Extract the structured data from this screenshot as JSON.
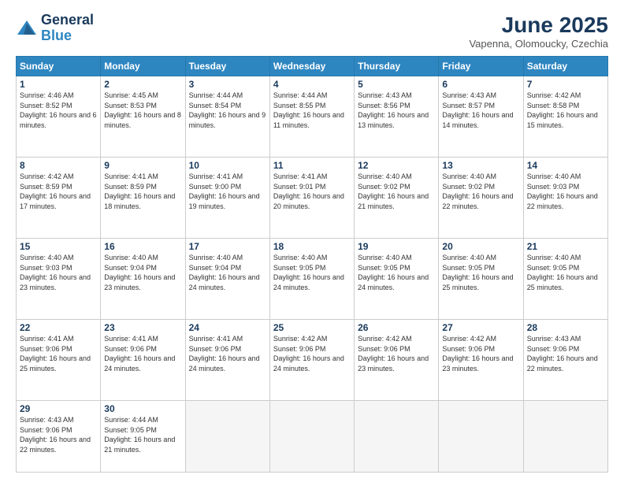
{
  "header": {
    "logo_line1": "General",
    "logo_line2": "Blue",
    "month_year": "June 2025",
    "location": "Vapenna, Olomoucky, Czechia"
  },
  "days_of_week": [
    "Sunday",
    "Monday",
    "Tuesday",
    "Wednesday",
    "Thursday",
    "Friday",
    "Saturday"
  ],
  "weeks": [
    [
      {
        "day": "1",
        "sunrise": "Sunrise: 4:46 AM",
        "sunset": "Sunset: 8:52 PM",
        "daylight": "Daylight: 16 hours and 6 minutes."
      },
      {
        "day": "2",
        "sunrise": "Sunrise: 4:45 AM",
        "sunset": "Sunset: 8:53 PM",
        "daylight": "Daylight: 16 hours and 8 minutes."
      },
      {
        "day": "3",
        "sunrise": "Sunrise: 4:44 AM",
        "sunset": "Sunset: 8:54 PM",
        "daylight": "Daylight: 16 hours and 9 minutes."
      },
      {
        "day": "4",
        "sunrise": "Sunrise: 4:44 AM",
        "sunset": "Sunset: 8:55 PM",
        "daylight": "Daylight: 16 hours and 11 minutes."
      },
      {
        "day": "5",
        "sunrise": "Sunrise: 4:43 AM",
        "sunset": "Sunset: 8:56 PM",
        "daylight": "Daylight: 16 hours and 13 minutes."
      },
      {
        "day": "6",
        "sunrise": "Sunrise: 4:43 AM",
        "sunset": "Sunset: 8:57 PM",
        "daylight": "Daylight: 16 hours and 14 minutes."
      },
      {
        "day": "7",
        "sunrise": "Sunrise: 4:42 AM",
        "sunset": "Sunset: 8:58 PM",
        "daylight": "Daylight: 16 hours and 15 minutes."
      }
    ],
    [
      {
        "day": "8",
        "sunrise": "Sunrise: 4:42 AM",
        "sunset": "Sunset: 8:59 PM",
        "daylight": "Daylight: 16 hours and 17 minutes."
      },
      {
        "day": "9",
        "sunrise": "Sunrise: 4:41 AM",
        "sunset": "Sunset: 8:59 PM",
        "daylight": "Daylight: 16 hours and 18 minutes."
      },
      {
        "day": "10",
        "sunrise": "Sunrise: 4:41 AM",
        "sunset": "Sunset: 9:00 PM",
        "daylight": "Daylight: 16 hours and 19 minutes."
      },
      {
        "day": "11",
        "sunrise": "Sunrise: 4:41 AM",
        "sunset": "Sunset: 9:01 PM",
        "daylight": "Daylight: 16 hours and 20 minutes."
      },
      {
        "day": "12",
        "sunrise": "Sunrise: 4:40 AM",
        "sunset": "Sunset: 9:02 PM",
        "daylight": "Daylight: 16 hours and 21 minutes."
      },
      {
        "day": "13",
        "sunrise": "Sunrise: 4:40 AM",
        "sunset": "Sunset: 9:02 PM",
        "daylight": "Daylight: 16 hours and 22 minutes."
      },
      {
        "day": "14",
        "sunrise": "Sunrise: 4:40 AM",
        "sunset": "Sunset: 9:03 PM",
        "daylight": "Daylight: 16 hours and 22 minutes."
      }
    ],
    [
      {
        "day": "15",
        "sunrise": "Sunrise: 4:40 AM",
        "sunset": "Sunset: 9:03 PM",
        "daylight": "Daylight: 16 hours and 23 minutes."
      },
      {
        "day": "16",
        "sunrise": "Sunrise: 4:40 AM",
        "sunset": "Sunset: 9:04 PM",
        "daylight": "Daylight: 16 hours and 23 minutes."
      },
      {
        "day": "17",
        "sunrise": "Sunrise: 4:40 AM",
        "sunset": "Sunset: 9:04 PM",
        "daylight": "Daylight: 16 hours and 24 minutes."
      },
      {
        "day": "18",
        "sunrise": "Sunrise: 4:40 AM",
        "sunset": "Sunset: 9:05 PM",
        "daylight": "Daylight: 16 hours and 24 minutes."
      },
      {
        "day": "19",
        "sunrise": "Sunrise: 4:40 AM",
        "sunset": "Sunset: 9:05 PM",
        "daylight": "Daylight: 16 hours and 24 minutes."
      },
      {
        "day": "20",
        "sunrise": "Sunrise: 4:40 AM",
        "sunset": "Sunset: 9:05 PM",
        "daylight": "Daylight: 16 hours and 25 minutes."
      },
      {
        "day": "21",
        "sunrise": "Sunrise: 4:40 AM",
        "sunset": "Sunset: 9:05 PM",
        "daylight": "Daylight: 16 hours and 25 minutes."
      }
    ],
    [
      {
        "day": "22",
        "sunrise": "Sunrise: 4:41 AM",
        "sunset": "Sunset: 9:06 PM",
        "daylight": "Daylight: 16 hours and 25 minutes."
      },
      {
        "day": "23",
        "sunrise": "Sunrise: 4:41 AM",
        "sunset": "Sunset: 9:06 PM",
        "daylight": "Daylight: 16 hours and 24 minutes."
      },
      {
        "day": "24",
        "sunrise": "Sunrise: 4:41 AM",
        "sunset": "Sunset: 9:06 PM",
        "daylight": "Daylight: 16 hours and 24 minutes."
      },
      {
        "day": "25",
        "sunrise": "Sunrise: 4:42 AM",
        "sunset": "Sunset: 9:06 PM",
        "daylight": "Daylight: 16 hours and 24 minutes."
      },
      {
        "day": "26",
        "sunrise": "Sunrise: 4:42 AM",
        "sunset": "Sunset: 9:06 PM",
        "daylight": "Daylight: 16 hours and 23 minutes."
      },
      {
        "day": "27",
        "sunrise": "Sunrise: 4:42 AM",
        "sunset": "Sunset: 9:06 PM",
        "daylight": "Daylight: 16 hours and 23 minutes."
      },
      {
        "day": "28",
        "sunrise": "Sunrise: 4:43 AM",
        "sunset": "Sunset: 9:06 PM",
        "daylight": "Daylight: 16 hours and 22 minutes."
      }
    ],
    [
      {
        "day": "29",
        "sunrise": "Sunrise: 4:43 AM",
        "sunset": "Sunset: 9:06 PM",
        "daylight": "Daylight: 16 hours and 22 minutes."
      },
      {
        "day": "30",
        "sunrise": "Sunrise: 4:44 AM",
        "sunset": "Sunset: 9:05 PM",
        "daylight": "Daylight: 16 hours and 21 minutes."
      },
      null,
      null,
      null,
      null,
      null
    ]
  ]
}
